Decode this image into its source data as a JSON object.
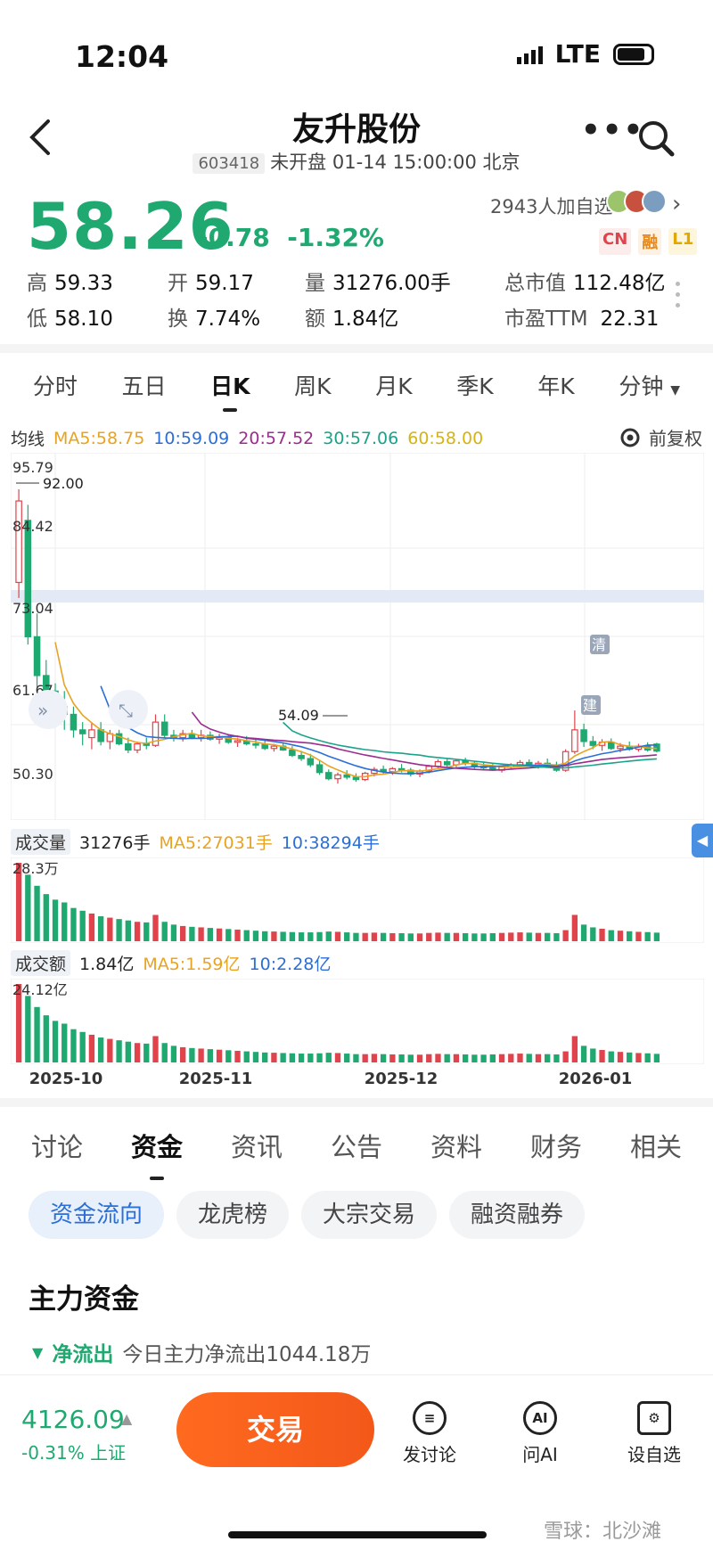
{
  "status": {
    "time": "12:04",
    "network": "LTE"
  },
  "header": {
    "title": "友升股份",
    "code": "603418",
    "market_status": "未开盘 01-14 15:00:00 北京"
  },
  "quote": {
    "price": "58.26",
    "change": "-0.78",
    "change_pct": "-1.32%",
    "followers": "2943人加自选",
    "badges": [
      "CN",
      "融",
      "L1"
    ],
    "high_label": "高",
    "high": "59.33",
    "low_label": "低",
    "low": "58.10",
    "open_label": "开",
    "open": "59.17",
    "turnover_label": "换",
    "turnover": "7.74%",
    "volume_label": "量",
    "volume": "31276.00手",
    "amount_label": "额",
    "amount": "1.84亿",
    "mktcap_label": "总市值",
    "mktcap": "112.48亿",
    "pe_label": "市盈TTM",
    "pe": "22.31"
  },
  "period_tabs": [
    "分时",
    "五日",
    "日K",
    "周K",
    "月K",
    "季K",
    "年K",
    "分钟"
  ],
  "active_period": 2,
  "ma_legend": {
    "label": "均线",
    "ma5": "MA5:58.75",
    "ma10": "10:59.09",
    "ma20": "20:57.52",
    "ma30": "30:57.06",
    "ma60": "60:58.00",
    "adjust": "前复权"
  },
  "colors": {
    "up": "#e0434b",
    "down": "#1fa971",
    "ma5": "#e8a320",
    "ma10": "#2b6fd6",
    "ma20": "#9b2d8f",
    "ma30": "#1aa38a",
    "ma60": "#e6c832",
    "accent": "#f3581a"
  },
  "chart_data": {
    "type": "candlestick",
    "y_ticks": [
      "95.79",
      "84.42",
      "73.04",
      "61.67",
      "50.30"
    ],
    "ylim": [
      50.3,
      95.79
    ],
    "annotations": {
      "high_marker": "92.00",
      "low_marker": "54.09",
      "tag1": "清",
      "tag2": "建"
    },
    "x_ticks": [
      "2025-10",
      "2025-11",
      "2025-12",
      "2026-01"
    ],
    "candles": [
      [
        80,
        92,
        78,
        90.5
      ],
      [
        88,
        90,
        72,
        73
      ],
      [
        73,
        76,
        66,
        68
      ],
      [
        68,
        70,
        64,
        66
      ],
      [
        66,
        67,
        62,
        64
      ],
      [
        64,
        66,
        61,
        63
      ],
      [
        63,
        64,
        60,
        61
      ],
      [
        61,
        62,
        59,
        60.5
      ],
      [
        60,
        62,
        58.5,
        61
      ],
      [
        61,
        62,
        59,
        59.5
      ],
      [
        59.5,
        61,
        58.5,
        60.5
      ],
      [
        60.5,
        61,
        59,
        59.2
      ],
      [
        59.2,
        60,
        58,
        58.4
      ],
      [
        58.4,
        59.5,
        58,
        59.2
      ],
      [
        59.2,
        60,
        58.5,
        59
      ],
      [
        59,
        63,
        58.8,
        62
      ],
      [
        62,
        63,
        60,
        60.3
      ],
      [
        60.3,
        61,
        59.5,
        60
      ],
      [
        60,
        61,
        59.5,
        60.5
      ],
      [
        60.5,
        61,
        59.8,
        60
      ],
      [
        60,
        61,
        59.5,
        60.3
      ],
      [
        60.3,
        60.8,
        59.6,
        59.8
      ],
      [
        59.8,
        60.5,
        59.2,
        60
      ],
      [
        60,
        60.4,
        59.2,
        59.4
      ],
      [
        59.4,
        60,
        58.8,
        59.6
      ],
      [
        59.6,
        60.2,
        59,
        59.2
      ],
      [
        59.2,
        59.8,
        58.6,
        59.1
      ],
      [
        59.1,
        59.6,
        58.4,
        58.6
      ],
      [
        58.6,
        59.2,
        58.2,
        58.9
      ],
      [
        58.9,
        59.4,
        58.3,
        58.4
      ],
      [
        58.4,
        58.9,
        57.5,
        57.7
      ],
      [
        57.7,
        58.3,
        57,
        57.3
      ],
      [
        57.3,
        57.9,
        56.2,
        56.5
      ],
      [
        56.5,
        57,
        55.2,
        55.5
      ],
      [
        55.5,
        55.9,
        54.5,
        54.7
      ],
      [
        54.7,
        55.5,
        54.09,
        55.2
      ],
      [
        55.2,
        55.8,
        54.6,
        54.9
      ],
      [
        54.9,
        55.4,
        54.3,
        54.6
      ],
      [
        54.6,
        55.6,
        54.4,
        55.4
      ],
      [
        55.4,
        56.2,
        55,
        55.9
      ],
      [
        55.9,
        56.4,
        55.3,
        55.6
      ],
      [
        55.6,
        56.2,
        55.2,
        56
      ],
      [
        56,
        56.6,
        55.5,
        55.8
      ],
      [
        55.8,
        56.1,
        55,
        55.3
      ],
      [
        55.3,
        55.9,
        54.9,
        55.7
      ],
      [
        55.7,
        56.5,
        55.4,
        56.3
      ],
      [
        56.3,
        57.2,
        56,
        56.9
      ],
      [
        56.9,
        57.3,
        56.2,
        56.5
      ],
      [
        56.5,
        57.2,
        56.2,
        57
      ],
      [
        57,
        57.4,
        56.4,
        56.7
      ],
      [
        56.7,
        57,
        56,
        56.3
      ],
      [
        56.3,
        56.8,
        55.8,
        56.1
      ],
      [
        56.1,
        56.6,
        55.7,
        55.8
      ],
      [
        55.8,
        56.4,
        55.5,
        56.2
      ],
      [
        56.2,
        56.7,
        55.9,
        56.5
      ],
      [
        56.5,
        57.1,
        56.2,
        56.8
      ],
      [
        56.8,
        57.2,
        56.3,
        56.4
      ],
      [
        56.4,
        57,
        56,
        56.7
      ],
      [
        56.7,
        57.3,
        56.3,
        56.5
      ],
      [
        56.5,
        56.9,
        55.6,
        55.8
      ],
      [
        55.8,
        58.5,
        55.6,
        58.2
      ],
      [
        58.2,
        63.5,
        57.9,
        61
      ],
      [
        61,
        61.8,
        58.8,
        59.5
      ],
      [
        59.5,
        60.2,
        58.5,
        59
      ],
      [
        59,
        59.8,
        58.3,
        59.4
      ],
      [
        59.4,
        59.9,
        58.4,
        58.6
      ],
      [
        58.6,
        59.3,
        58.1,
        58.9
      ],
      [
        58.9,
        59.5,
        58.3,
        58.5
      ],
      [
        58.5,
        59.2,
        58.2,
        58.9
      ],
      [
        58.9,
        59.4,
        58.2,
        58.4
      ],
      [
        59.17,
        59.33,
        58.1,
        58.26
      ]
    ],
    "volume": {
      "label": "成交量",
      "value": "31276手",
      "ma5": "MA5:27031手",
      "ma10": "10:38294手",
      "max_label": "28.3万",
      "values": [
        283,
        240,
        200,
        170,
        150,
        140,
        120,
        110,
        100,
        90,
        85,
        80,
        75,
        70,
        68,
        95,
        70,
        60,
        55,
        52,
        50,
        48,
        46,
        44,
        42,
        40,
        38,
        36,
        35,
        34,
        33,
        32,
        32,
        33,
        35,
        34,
        32,
        30,
        30,
        31,
        30,
        29,
        29,
        28,
        28,
        30,
        31,
        30,
        30,
        29,
        28,
        28,
        29,
        30,
        31,
        32,
        31,
        30,
        30,
        29,
        40,
        95,
        60,
        50,
        45,
        40,
        38,
        36,
        34,
        33,
        31
      ]
    },
    "amount": {
      "label": "成交额",
      "value": "1.84亿",
      "ma5": "MA5:1.59亿",
      "ma10": "10:2.28亿",
      "max_label": "24.12亿"
    }
  },
  "content_tabs": [
    "讨论",
    "资金",
    "资讯",
    "公告",
    "资料",
    "财务",
    "相关"
  ],
  "active_content_tab": 1,
  "chips": [
    "资金流向",
    "龙虎榜",
    "大宗交易",
    "融资融券"
  ],
  "section": {
    "title": "主力资金",
    "flow_label": "净流出",
    "flow_text": "今日主力净流出1044.18万"
  },
  "bottom": {
    "index_value": "4126.09",
    "index_change": "-0.31%",
    "index_name": "上证",
    "trade": "交易",
    "discuss": "发讨论",
    "ask_ai": "问AI",
    "ai_icon": "AI",
    "watch": "设自选"
  },
  "watermark": "雪球：北沙滩"
}
